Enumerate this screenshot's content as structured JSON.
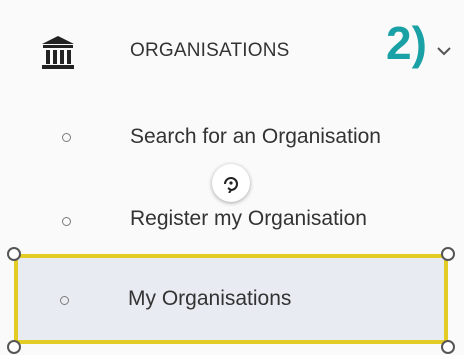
{
  "menu": {
    "header": {
      "label": "ORGANISATIONS",
      "icon": "bank-icon",
      "expanded": true
    },
    "items": [
      {
        "label": "Search for an Organisation",
        "selected": false
      },
      {
        "label": "Register my Organisation",
        "selected": false
      },
      {
        "label": "My Organisations",
        "selected": true
      }
    ]
  },
  "annotation": {
    "step_label": "2)",
    "color": "#1aa1a5"
  },
  "highlight": {
    "border_color": "#e3cc25",
    "selected_background": "#e8ecf2"
  }
}
